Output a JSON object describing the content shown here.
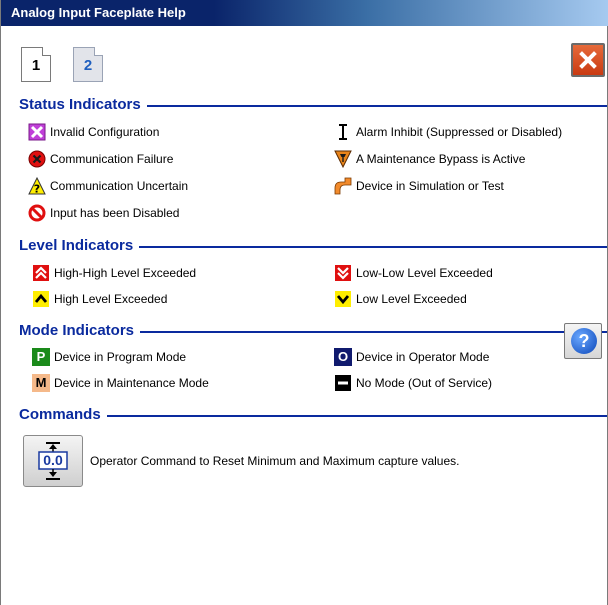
{
  "window": {
    "title": "Analog Input Faceplate Help"
  },
  "tabs": [
    {
      "label": "1"
    },
    {
      "label": "2"
    }
  ],
  "sections": {
    "status": "Status Indicators",
    "level": "Level Indicators",
    "mode": "Mode Indicators",
    "commands": "Commands"
  },
  "status_items": {
    "invalid_config": "Invalid Configuration",
    "comm_failure": "Communication Failure",
    "comm_uncertain": "Communication Uncertain",
    "input_disabled": "Input has been Disabled",
    "alarm_inhibit": "Alarm Inhibit (Suppressed or Disabled)",
    "maint_bypass": "A Maintenance Bypass is Active",
    "simulation": "Device in Simulation or Test"
  },
  "level_items": {
    "hh": "High-High Level Exceeded",
    "h": "High Level Exceeded",
    "ll": "Low-Low Level Exceeded",
    "l": "Low Level Exceeded"
  },
  "mode_items": {
    "program": "Device in Program Mode",
    "maintenance": "Device in Maintenance Mode",
    "operator": "Device in Operator Mode",
    "no_mode": "No Mode (Out of Service)",
    "program_letter": "P",
    "maintenance_letter": "M",
    "operator_letter": "O"
  },
  "commands": {
    "reset_button_value": "0.0",
    "reset_desc": "Operator Command to Reset Minimum and Maximum capture values."
  },
  "help": {
    "glyph": "?"
  },
  "colors": {
    "section_blue": "#0a2a9e",
    "titlebar": "#0a246a",
    "alarm_red": "#e01010",
    "alarm_yellow": "#ffee00",
    "program_green": "#1a8a1a",
    "maintenance_tan": "#f5b98a",
    "operator_navy": "#101a6e"
  }
}
